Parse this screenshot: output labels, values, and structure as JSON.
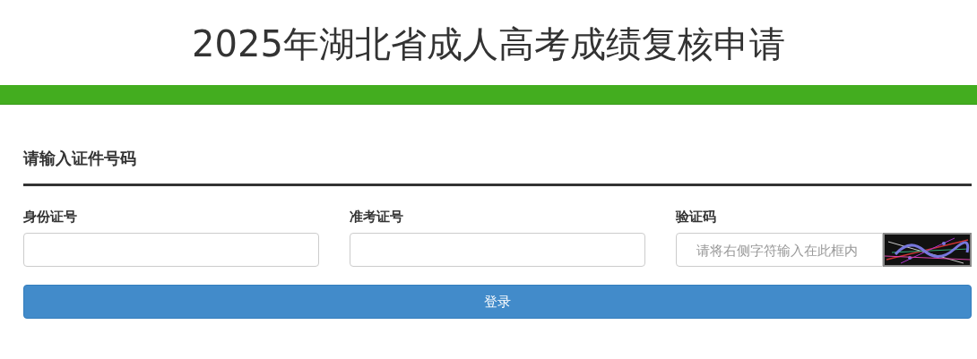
{
  "page_title": "2025年湖北省成人高考成绩复核申请",
  "section_heading": "请输入证件号码",
  "fields": [
    {
      "label": "身份证号",
      "kind": "text"
    },
    {
      "label": "准考证号",
      "kind": "text"
    },
    {
      "label": "验证码",
      "kind": "captcha",
      "placeholder": "请将右侧字符输入在此框内"
    }
  ],
  "login_button": "登录"
}
